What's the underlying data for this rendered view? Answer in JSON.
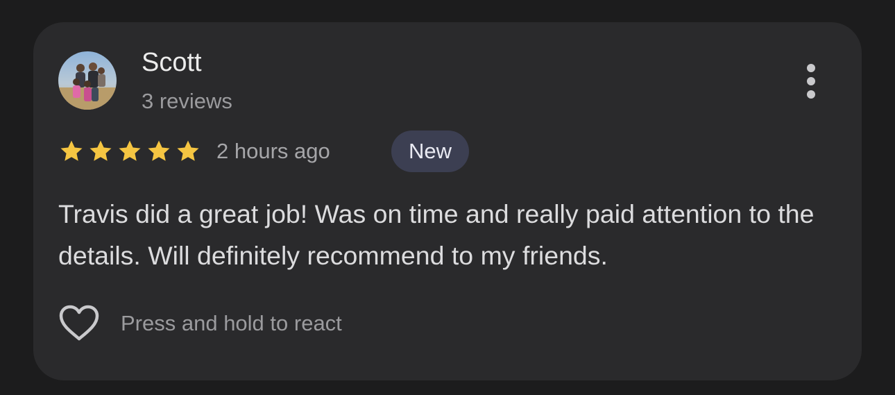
{
  "review": {
    "reviewer_name": "Scott",
    "review_count": "3 reviews",
    "rating": 5,
    "rating_max": 5,
    "timestamp": "2 hours ago",
    "badge": "New",
    "text": "Travis did a great job! Was on time and really paid attention to the details. Will definitely recommend to my friends.",
    "react_hint": "Press and hold to react"
  },
  "icons": {
    "more": "more-vert-icon",
    "star": "star-icon",
    "react": "heart-outline-icon"
  },
  "colors": {
    "background": "#1c1c1d",
    "card": "#2a2a2c",
    "star": "#f5c542",
    "badge_bg": "#3c3f52"
  }
}
